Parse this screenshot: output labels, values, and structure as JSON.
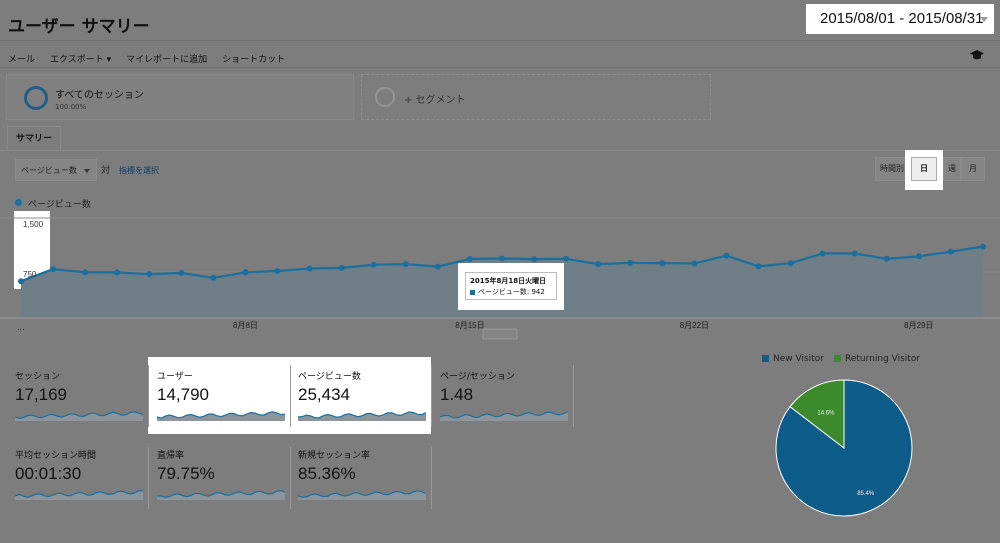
{
  "header": {
    "title": "ユーザー サマリー",
    "date_range": "2015/08/01 - 2015/08/31"
  },
  "toolbar": {
    "items": [
      "メール",
      "エクスポート ▾",
      "マイレポートに追加",
      "ショートカット"
    ]
  },
  "segments": {
    "active_name": "すべてのセッション",
    "active_pct": "100.00%",
    "add_label": "+ セグメント"
  },
  "tabs": {
    "summary": "サマリー"
  },
  "controls": {
    "metric": "ページビュー数",
    "vs": "対",
    "pick_metric": "指標を選択",
    "granularity": {
      "hour": "時間別",
      "day": "日",
      "week": "週",
      "month": "月"
    }
  },
  "chart_data": {
    "type": "area",
    "series": [
      {
        "name": "ページビュー数",
        "values": [
          588,
          780,
          730,
          728,
          700,
          720,
          640,
          730,
          750,
          790,
          800,
          850,
          860,
          820,
          942,
          950,
          940,
          945,
          860,
          880,
          875,
          870,
          995,
          825,
          875,
          1030,
          1030,
          945,
          985,
          1060,
          1140
        ]
      }
    ],
    "x": [
      "8/1",
      "8/2",
      "8/3",
      "8/4",
      "8/5",
      "8/6",
      "8/7",
      "8/8",
      "8/9",
      "8/10",
      "8/11",
      "8/12",
      "8/13",
      "8/14",
      "8/15",
      "8/16",
      "8/17",
      "8/18",
      "8/19",
      "8/20",
      "8/21",
      "8/22",
      "8/23",
      "8/24",
      "8/25",
      "8/26",
      "8/27",
      "8/28",
      "8/29",
      "8/30",
      "8/31"
    ],
    "y_ticks": [
      "1,500",
      "750"
    ],
    "x_labels": [
      {
        "i": 7,
        "text": "8月8日"
      },
      {
        "i": 14,
        "text": "8月15日"
      },
      {
        "i": 21,
        "text": "8月22日"
      },
      {
        "i": 28,
        "text": "8月29日"
      }
    ],
    "x_first_label": "...",
    "ylim": [
      0,
      1500
    ],
    "tooltip": {
      "date": "2015年8月18日火曜日",
      "label": "ページビュー数: 942"
    },
    "color": "#1a6f9e"
  },
  "metrics": [
    {
      "label": "セッション",
      "value": "17,169"
    },
    {
      "label": "ユーザー",
      "value": "14,790"
    },
    {
      "label": "ページビュー数",
      "value": "25,434"
    },
    {
      "label": "ページ/セッション",
      "value": "1.48"
    },
    {
      "label": "平均セッション時間",
      "value": "00:01:30"
    },
    {
      "label": "直帰率",
      "value": "79.75%"
    },
    {
      "label": "新規セッション率",
      "value": "85.36%"
    }
  ],
  "pie": {
    "legend": [
      {
        "name": "New Visitor",
        "color": "#0e5c8a"
      },
      {
        "name": "Returning Visitor",
        "color": "#3d8a2d"
      }
    ],
    "slices": [
      {
        "name": "New Visitor",
        "value": 85.4,
        "label": "85.4%"
      },
      {
        "name": "Returning Visitor",
        "value": 14.6,
        "label": "14.6%"
      }
    ]
  }
}
